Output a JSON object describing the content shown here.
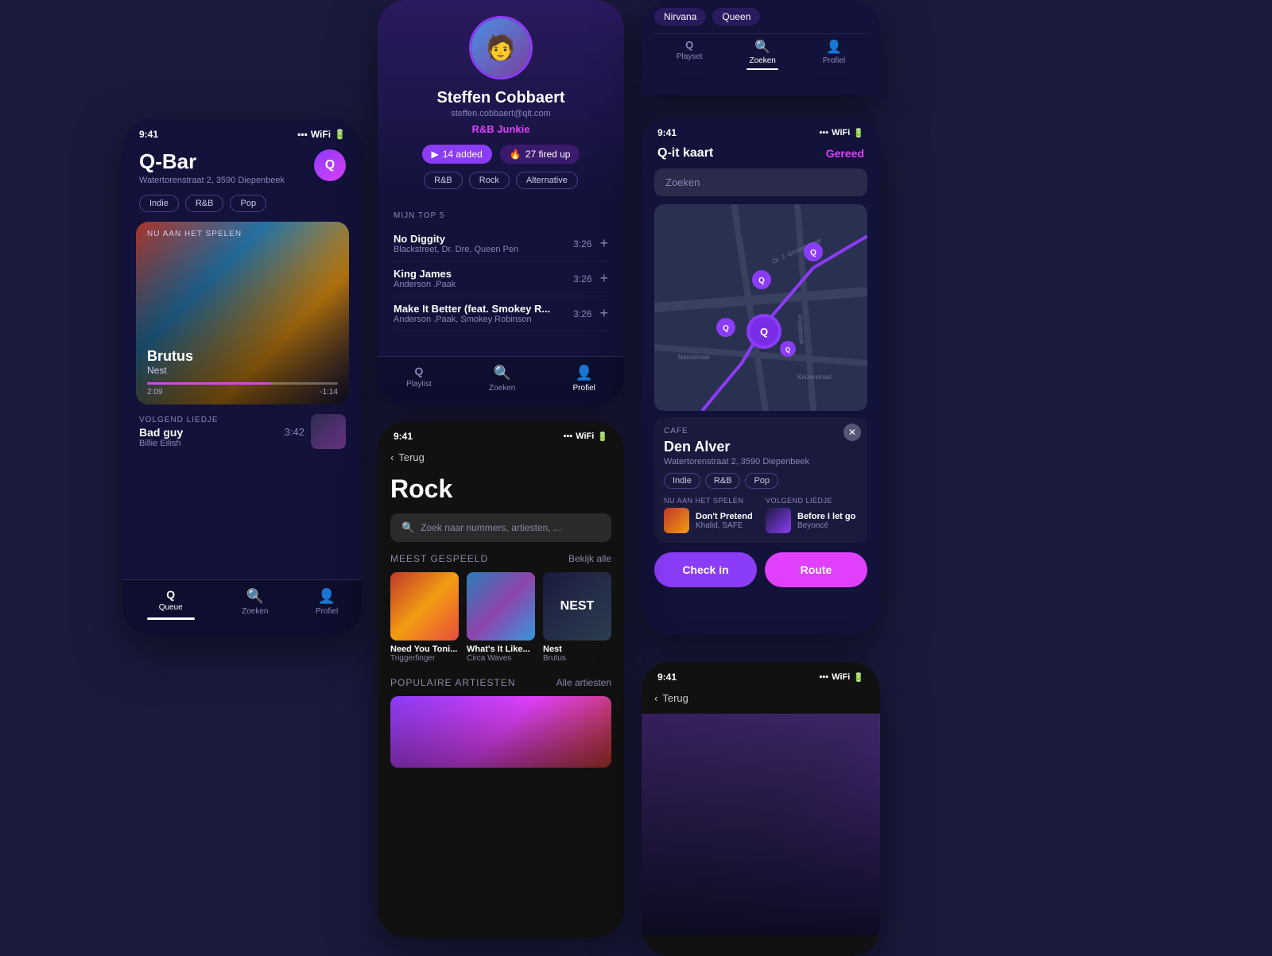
{
  "phone1": {
    "status_time": "9:41",
    "venue_name": "Q-Bar",
    "venue_address": "Watertorenstraat 2, 3590 Diepenbeek",
    "avatar_letter": "Q",
    "genre_tags": [
      "Indie",
      "R&B",
      "Pop"
    ],
    "now_playing_label": "NU AAN HET SPELEN",
    "current_track": "Brutus",
    "current_artist": "Nest",
    "current_time": "2:09",
    "remaining_time": "-1:14",
    "progress_percent": 65,
    "next_label": "VOLGEND LIEDJE",
    "next_track": "Bad guy",
    "next_artist": "Billie Eilish",
    "next_duration": "3:42",
    "nav": [
      {
        "label": "Queue",
        "icon": "Q",
        "active": true
      },
      {
        "label": "Zoeken",
        "icon": "🔍",
        "active": false
      },
      {
        "label": "Profiel",
        "icon": "👤",
        "active": false
      }
    ]
  },
  "phone2": {
    "profile_name": "Steffen Cobbaert",
    "profile_email": "steffen.cobbaert@qit.com",
    "profile_badge": "R&B Junkie",
    "stat1_count": "14 added",
    "stat2_count": "27 fired up",
    "genres": [
      "R&B",
      "Rock",
      "Alternative"
    ],
    "top5_label": "MIJN TOP 5",
    "tracks": [
      {
        "name": "No Diggity",
        "artists": "Blackstreet, Dr. Dre, Queen Pen",
        "duration": "3:26"
      },
      {
        "name": "King James",
        "artists": "Anderson .Paak",
        "duration": "3:26"
      },
      {
        "name": "Make It Better (feat. Smokey R...",
        "artists": "Anderson .Paak, Smokey Robinson",
        "duration": "3:26"
      }
    ],
    "nav": [
      {
        "label": "Playlist",
        "icon": "Q",
        "active": false
      },
      {
        "label": "Zoeken",
        "icon": "🔍",
        "active": false
      },
      {
        "label": "Profiel",
        "icon": "👤",
        "active": true
      }
    ]
  },
  "phone3": {
    "artists": [
      "Nirvana",
      "Queen"
    ],
    "nav": [
      {
        "label": "Playset",
        "icon": "Q",
        "active": false
      },
      {
        "label": "Zoeken",
        "icon": "🔍",
        "active": true
      },
      {
        "label": "Profiel",
        "icon": "👤",
        "active": false
      }
    ]
  },
  "phone4": {
    "status_time": "9:41",
    "title": "Q-it kaart",
    "gereed": "Gereed",
    "search_placeholder": "Zoeken",
    "venue_type": "CAFE",
    "venue_name": "Den Alver",
    "venue_address": "Watertorenstraat 2, 3590 Diepenbeek",
    "venue_genres": [
      "Indie",
      "R&B",
      "Pop"
    ],
    "now_playing_label": "NU AAN HET SPELEN",
    "now_track": "Don't Pretend",
    "now_artist": "Khalid, SAFE",
    "next_label": "VOLGEND LIEDJE",
    "next_track": "Before I let go",
    "next_artist": "Beyoncé",
    "btn_checkin": "Check in",
    "btn_route": "Route",
    "map_markers": [
      "Q",
      "Q",
      "Q",
      "Q",
      "Q"
    ]
  },
  "phone5": {
    "status_time": "9:41",
    "back_label": "Terug",
    "genre": "Rock",
    "search_placeholder": "Zoek naar nummers, artiesten, ...",
    "most_played_label": "MEEST GESPEELD",
    "bekijk_alle": "Bekijk alle",
    "albums": [
      {
        "name": "Need You Toni...",
        "artist": "Triggerfinger",
        "art_class": "album-art1"
      },
      {
        "name": "What's It Like...",
        "artist": "Circa Waves",
        "art_class": "album-art2"
      },
      {
        "name": "Nest",
        "artist": "Brutus",
        "art_class": "album-art3"
      }
    ],
    "popular_artists_label": "POPULAIRE ARTIESTEN",
    "alle_artiesten": "Alle artiesten"
  },
  "phone6": {
    "status_time": "9:41",
    "back_label": "Terug"
  }
}
